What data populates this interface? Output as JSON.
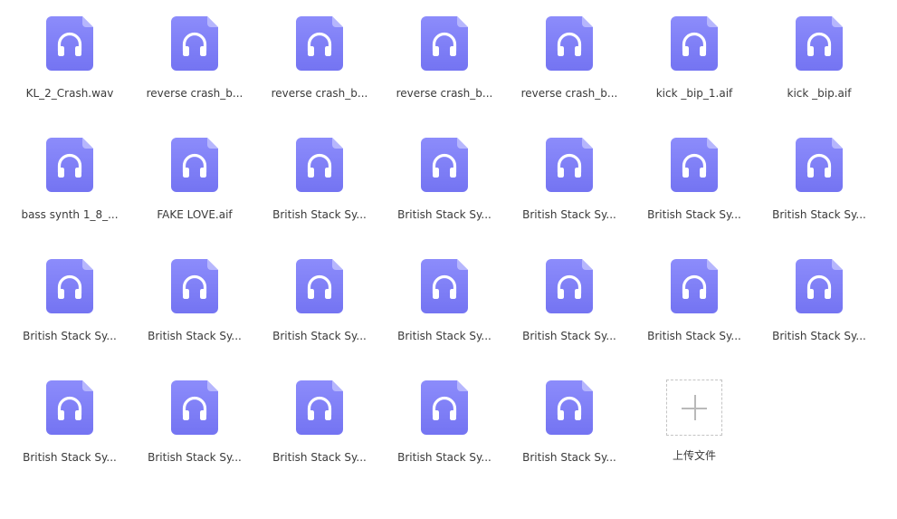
{
  "colors": {
    "icon_fill_top": "#8c8cfb",
    "icon_fill_bottom": "#7474f2",
    "icon_fold": "#b6b6fd",
    "icon_glyph": "#ffffff"
  },
  "file_icon": "headphones-icon",
  "files": [
    {
      "name": "KL_2_Crash.wav"
    },
    {
      "name": "reverse crash_b..."
    },
    {
      "name": "reverse crash_b..."
    },
    {
      "name": "reverse crash_b..."
    },
    {
      "name": "reverse crash_b..."
    },
    {
      "name": "kick _bip_1.aif"
    },
    {
      "name": "kick _bip.aif"
    },
    {
      "name": "bass synth 1_8_..."
    },
    {
      "name": "FAKE LOVE.aif"
    },
    {
      "name": "British Stack Sy..."
    },
    {
      "name": "British Stack Sy..."
    },
    {
      "name": "British Stack Sy..."
    },
    {
      "name": "British Stack Sy..."
    },
    {
      "name": "British Stack Sy..."
    },
    {
      "name": "British Stack Sy..."
    },
    {
      "name": "British Stack Sy..."
    },
    {
      "name": "British Stack Sy..."
    },
    {
      "name": "British Stack Sy..."
    },
    {
      "name": "British Stack Sy..."
    },
    {
      "name": "British Stack Sy..."
    },
    {
      "name": "British Stack Sy..."
    },
    {
      "name": "British Stack Sy..."
    },
    {
      "name": "British Stack Sy..."
    },
    {
      "name": "British Stack Sy..."
    },
    {
      "name": "British Stack Sy..."
    },
    {
      "name": "British Stack Sy..."
    }
  ],
  "upload": {
    "label": "上传文件",
    "icon": "plus-icon"
  }
}
